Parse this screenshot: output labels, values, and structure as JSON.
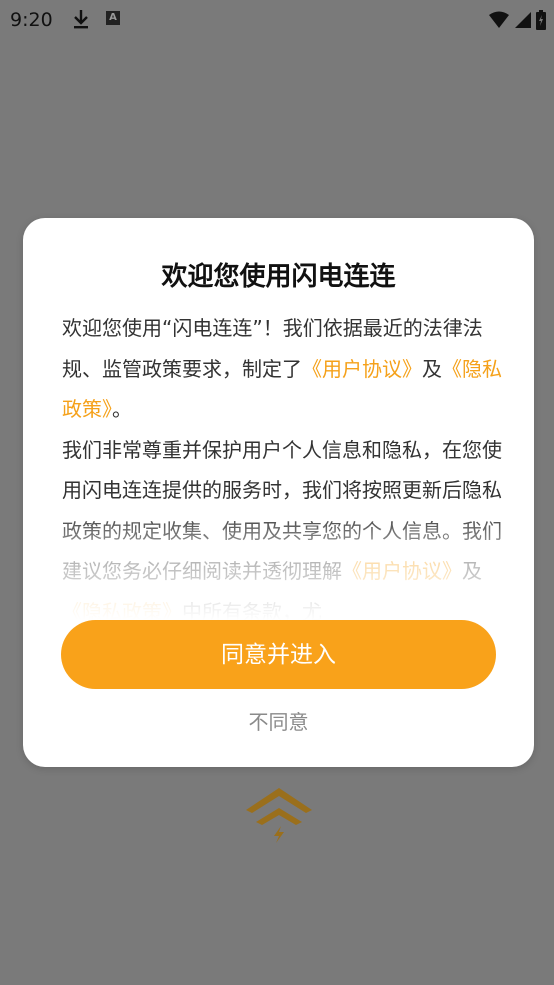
{
  "status_bar": {
    "time": "9:20",
    "icons": [
      "download-icon",
      "a-icon",
      "wifi-icon",
      "signal-icon",
      "battery-icon"
    ],
    "a_label": "A"
  },
  "dialog": {
    "title": "欢迎您使用闪电连连",
    "para1_text1": "欢迎您使用“闪电连连”！我们依据最近的法律法规、监管政策要求，制定了",
    "link_user_agreement": "《用户协议》",
    "para1_text2": "及",
    "link_privacy_policy": "《隐私政策》",
    "para1_text3": "。",
    "para2": "我们非常尊重并保护用户个人信息和隐私，在您使用闪电连连提供的服务时，我们将按照更新后隐私政策的规定收集、使用及共享您的个人信息。我们建议您务必仔细阅读并透彻理解",
    "para2_link1": "《用户协议》",
    "para2_text2": "及",
    "para2_link2": "《隐私政策》",
    "para2_text3": "中所有条款，尤",
    "agree_label": "同意并进入",
    "disagree_label": "不同意"
  },
  "colors": {
    "accent": "#f9a21a",
    "link": "#f5a11a",
    "overlay": "#7a7a7a"
  }
}
